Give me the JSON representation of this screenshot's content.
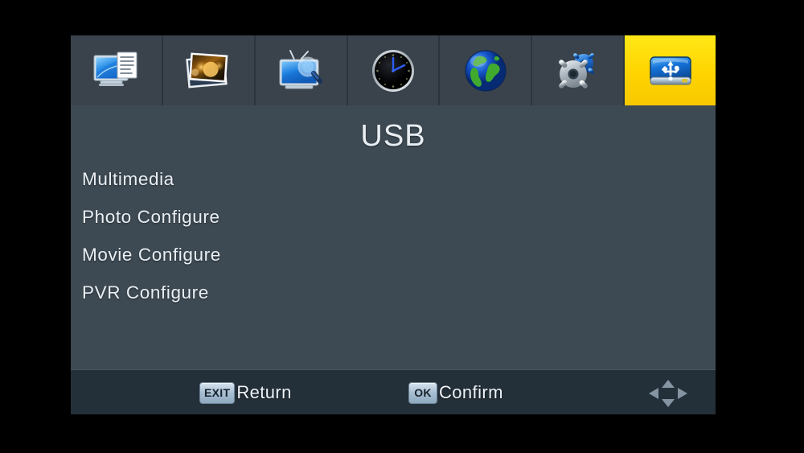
{
  "device": {
    "screen_title": "USB",
    "highlight_color": "#ffd400",
    "panel_color": "#3e4a53",
    "bottom_bar_color": "#243039",
    "text_color": "#e9eff4"
  },
  "iconbar": {
    "items": [
      {
        "name": "program-edit",
        "icon": "monitor-document-icon",
        "selected": false
      },
      {
        "name": "picture-settings",
        "icon": "photo-image-icon",
        "selected": false
      },
      {
        "name": "channel-search",
        "icon": "tv-magnifier-icon",
        "selected": false
      },
      {
        "name": "time-settings",
        "icon": "clock-icon",
        "selected": false
      },
      {
        "name": "network-settings",
        "icon": "globe-icon",
        "selected": false
      },
      {
        "name": "system-settings",
        "icon": "gears-icon",
        "selected": false
      },
      {
        "name": "usb",
        "icon": "usb-drive-icon",
        "selected": true
      }
    ]
  },
  "menu": {
    "items": [
      {
        "label": "Multimedia"
      },
      {
        "label": "Photo Configure"
      },
      {
        "label": "Movie Configure"
      },
      {
        "label": "PVR Configure"
      }
    ]
  },
  "bottombar": {
    "return": {
      "key": "EXIT",
      "label": "Return"
    },
    "confirm": {
      "key": "OK",
      "label": "Confirm"
    },
    "navpad_icon": "dpad-arrows-icon"
  }
}
